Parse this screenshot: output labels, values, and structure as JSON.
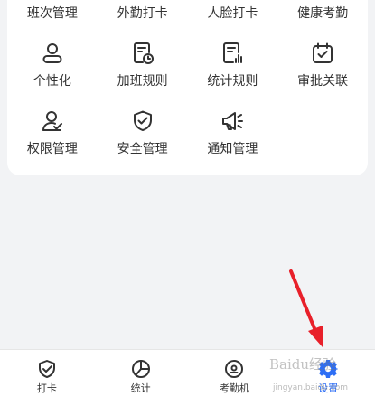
{
  "top_row": [
    "班次管理",
    "外勤打卡",
    "人脸打卡",
    "健康考勤"
  ],
  "row2": [
    {
      "label": "个性化",
      "icon": "person-icon"
    },
    {
      "label": "加班规则",
      "icon": "overtime-rule-icon"
    },
    {
      "label": "统计规则",
      "icon": "stats-rule-icon"
    },
    {
      "label": "审批关联",
      "icon": "approval-calendar-icon"
    }
  ],
  "row3": [
    {
      "label": "权限管理",
      "icon": "permission-icon"
    },
    {
      "label": "安全管理",
      "icon": "security-shield-icon"
    },
    {
      "label": "通知管理",
      "icon": "notification-icon"
    }
  ],
  "tabbar": [
    {
      "label": "打卡",
      "icon": "checkin-icon"
    },
    {
      "label": "统计",
      "icon": "stats-pie-icon"
    },
    {
      "label": "考勤机",
      "icon": "attendance-machine-icon"
    },
    {
      "label": "设置",
      "icon": "settings-gear-icon",
      "active": true
    }
  ],
  "watermark": {
    "text": "Baidu经验",
    "url": "jingyan.baidu.com"
  },
  "colors": {
    "accent": "#2d6ef5",
    "annotation_arrow": "#e8202a",
    "background": "#f2f3f5"
  }
}
